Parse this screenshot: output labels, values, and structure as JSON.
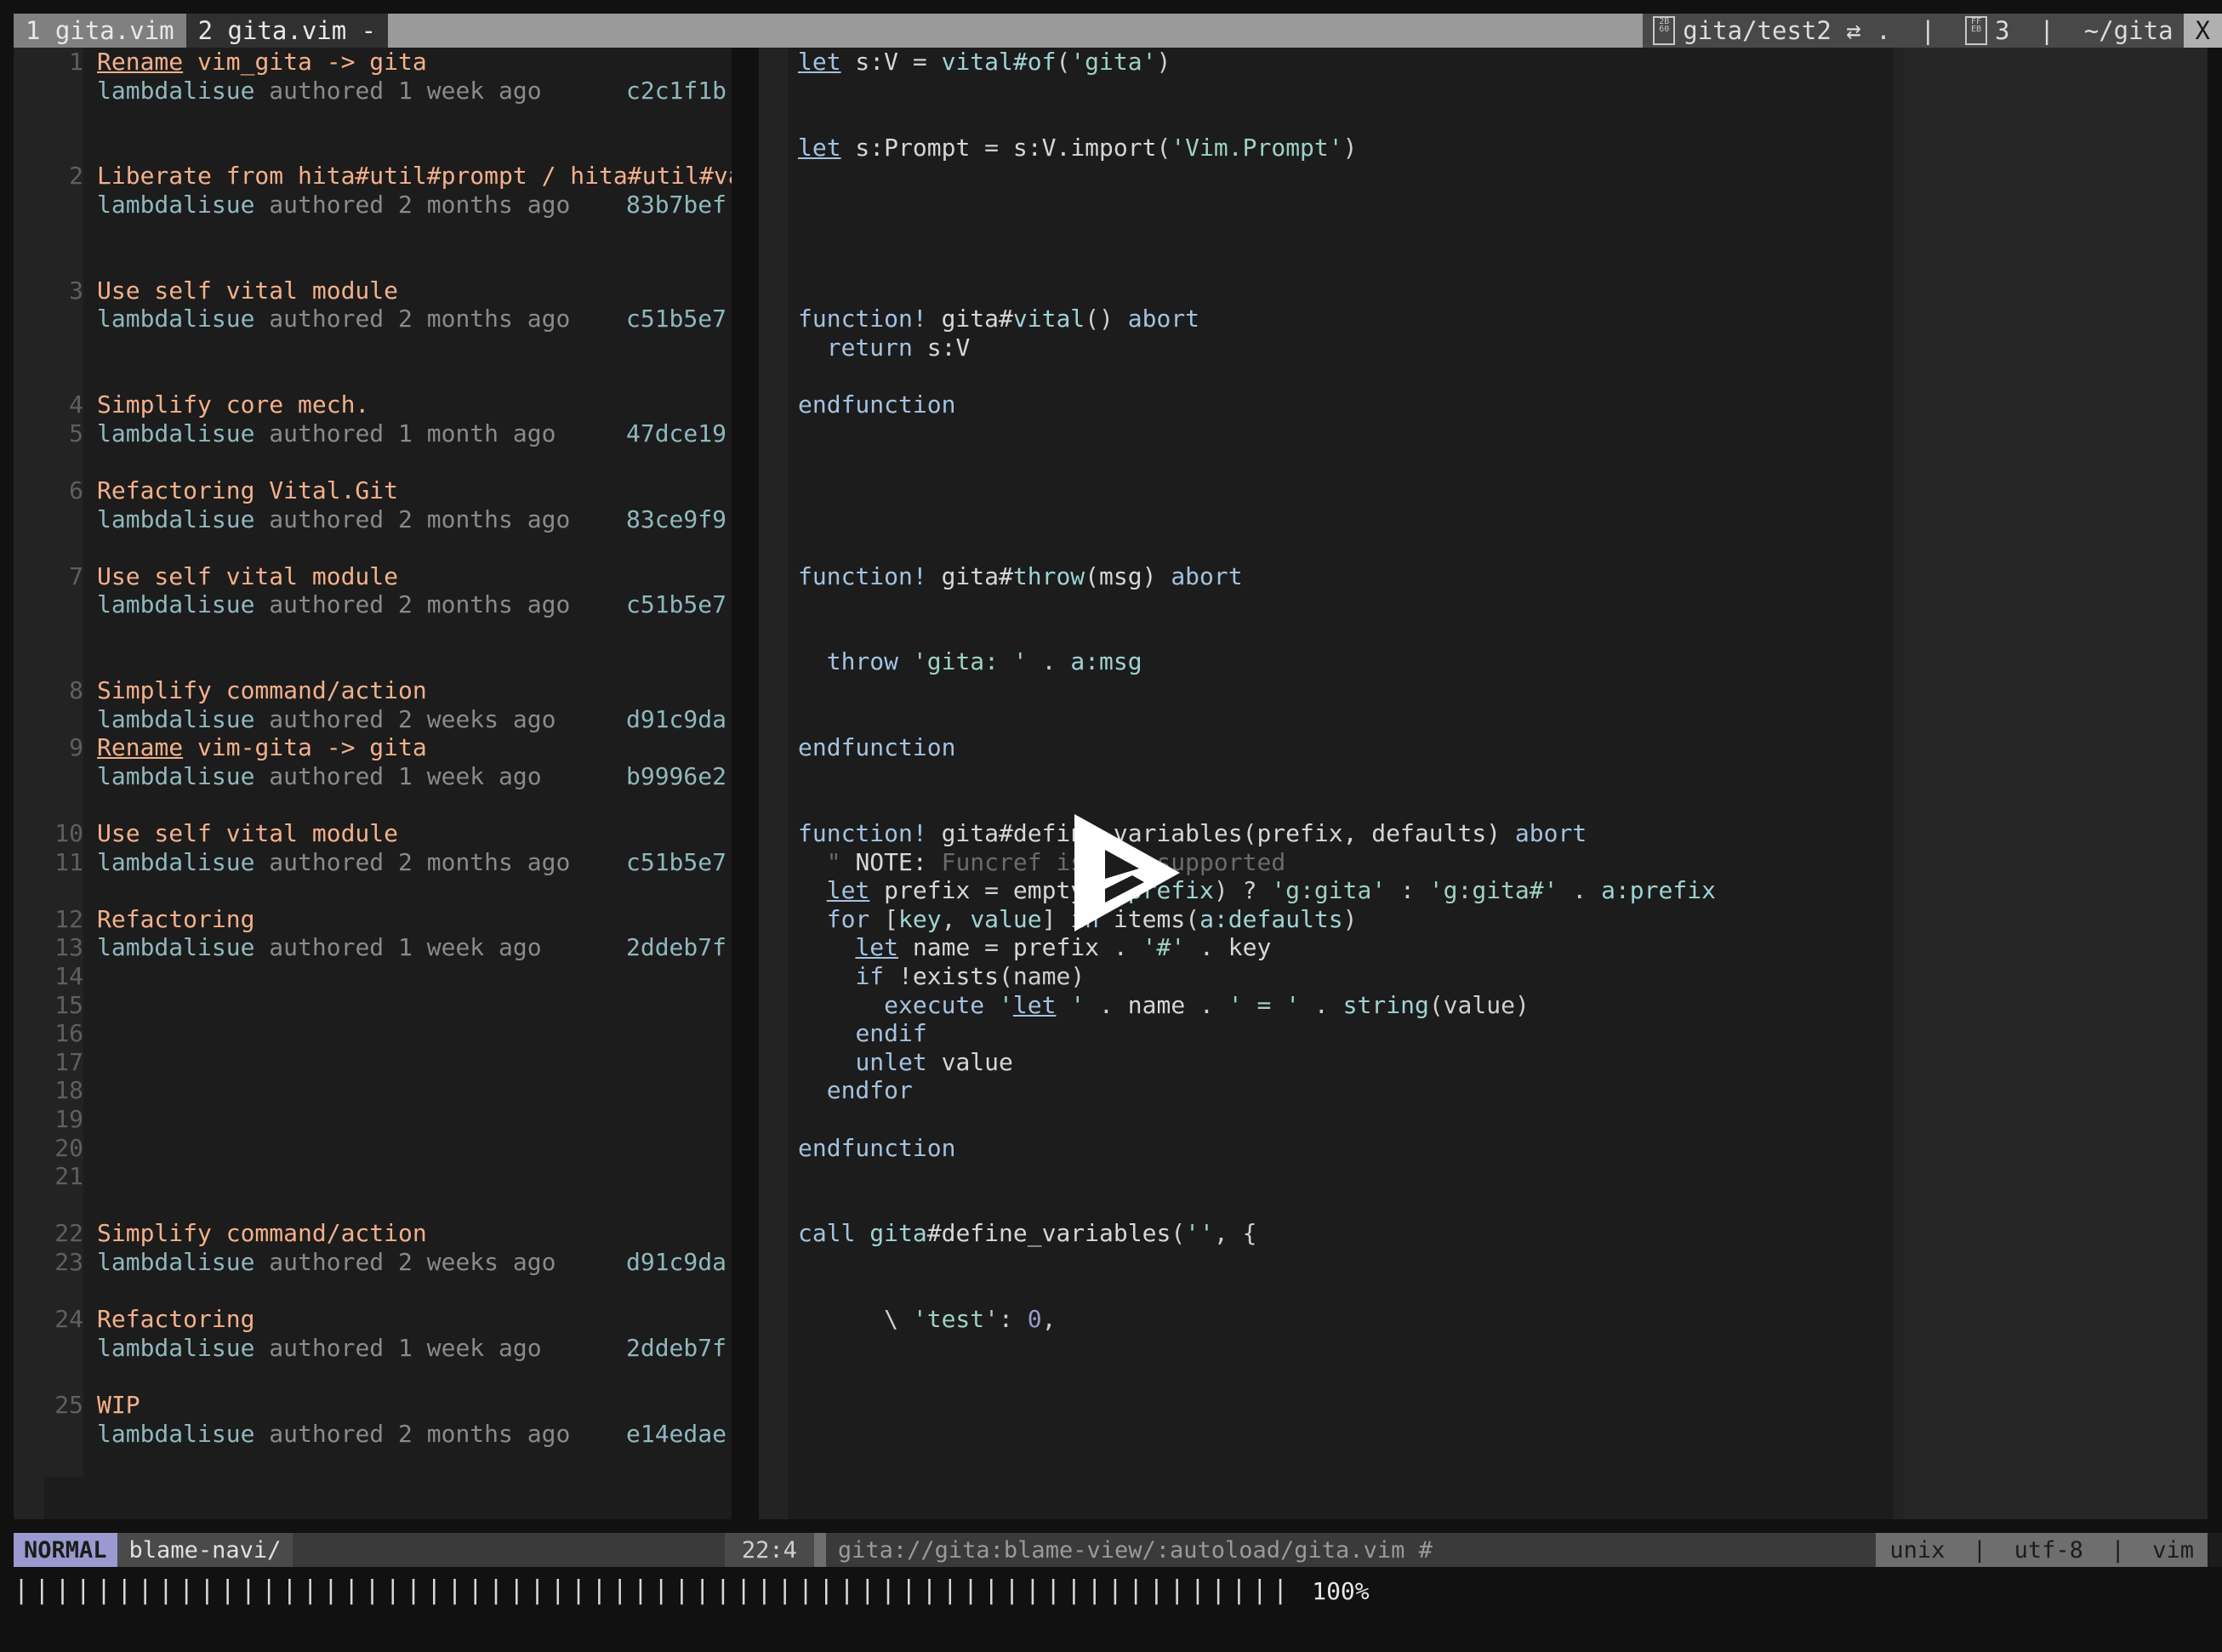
{
  "window": {
    "background": "#111111",
    "accent": "#9a9ad0"
  },
  "tabline": {
    "tabs": [
      {
        "label": "1 gita.vim",
        "active": false
      },
      {
        "label": "2 gita.vim -",
        "active": true
      }
    ],
    "info": {
      "branch_icon": "branch-box-glyph",
      "branch_glyph_top": "2B",
      "branch_glyph_bottom": "60",
      "branch": "gita/test2 ⇄ .",
      "divider1": "|",
      "count_glyph_top": "FF",
      "count_glyph_bottom": "EB",
      "count": "3",
      "divider2": "|",
      "cwd": "~/gita"
    },
    "close_label": "X"
  },
  "blame_pane": {
    "name": "blame-navi",
    "rows": [
      {
        "lnum": "1",
        "type": "title",
        "title_underline": "Rename",
        "title": " vim_gita -> gita"
      },
      {
        "lnum": "",
        "type": "author",
        "author": "lambdalisue",
        "meta": " authored 1 week ago",
        "hash": "c2c1f1b"
      },
      {
        "lnum": "",
        "type": "blank"
      },
      {
        "lnum": "",
        "type": "blank"
      },
      {
        "lnum": "2",
        "type": "title",
        "title": "Liberate from hita#util#prompt / hita#util#va"
      },
      {
        "lnum": "",
        "type": "author",
        "author": "lambdalisue",
        "meta": " authored 2 months ago",
        "hash": "83b7bef"
      },
      {
        "lnum": "",
        "type": "blank"
      },
      {
        "lnum": "",
        "type": "blank"
      },
      {
        "lnum": "3",
        "type": "title",
        "title": "Use self vital module"
      },
      {
        "lnum": "",
        "type": "author",
        "author": "lambdalisue",
        "meta": " authored 2 months ago",
        "hash": "c51b5e7"
      },
      {
        "lnum": "",
        "type": "blank"
      },
      {
        "lnum": "",
        "type": "blank"
      },
      {
        "lnum": "4",
        "type": "title",
        "title": "Simplify core mech."
      },
      {
        "lnum": "5",
        "type": "author",
        "author": "lambdalisue",
        "meta": " authored 1 month ago",
        "hash": "47dce19"
      },
      {
        "lnum": "",
        "type": "blank"
      },
      {
        "lnum": "6",
        "type": "title",
        "title": "Refactoring Vital.Git"
      },
      {
        "lnum": "",
        "type": "author",
        "author": "lambdalisue",
        "meta": " authored 2 months ago",
        "hash": "83ce9f9"
      },
      {
        "lnum": "",
        "type": "blank"
      },
      {
        "lnum": "7",
        "type": "title",
        "title": "Use self vital module"
      },
      {
        "lnum": "",
        "type": "author",
        "author": "lambdalisue",
        "meta": " authored 2 months ago",
        "hash": "c51b5e7"
      },
      {
        "lnum": "",
        "type": "blank"
      },
      {
        "lnum": "",
        "type": "blank"
      },
      {
        "lnum": "8",
        "type": "title",
        "title": "Simplify command/action"
      },
      {
        "lnum": "",
        "type": "author",
        "author": "lambdalisue",
        "meta": " authored 2 weeks ago",
        "hash": "d91c9da"
      },
      {
        "lnum": "9",
        "type": "title",
        "title_underline": "Rename",
        "title": " vim-gita -> gita"
      },
      {
        "lnum": "",
        "type": "author",
        "author": "lambdalisue",
        "meta": " authored 1 week ago",
        "hash": "b9996e2"
      },
      {
        "lnum": "",
        "type": "blank"
      },
      {
        "lnum": "10",
        "type": "title",
        "title": "Use self vital module"
      },
      {
        "lnum": "11",
        "type": "author",
        "author": "lambdalisue",
        "meta": " authored 2 months ago",
        "hash": "c51b5e7"
      },
      {
        "lnum": "",
        "type": "blank"
      },
      {
        "lnum": "12",
        "type": "title",
        "title": "Refactoring"
      },
      {
        "lnum": "13",
        "type": "author",
        "author": "lambdalisue",
        "meta": " authored 1 week ago",
        "hash": "2ddeb7f"
      },
      {
        "lnum": "14",
        "type": "blank"
      },
      {
        "lnum": "15",
        "type": "blank"
      },
      {
        "lnum": "16",
        "type": "blank"
      },
      {
        "lnum": "17",
        "type": "blank"
      },
      {
        "lnum": "18",
        "type": "blank"
      },
      {
        "lnum": "19",
        "type": "blank"
      },
      {
        "lnum": "20",
        "type": "blank"
      },
      {
        "lnum": "21",
        "type": "blank"
      },
      {
        "lnum": "",
        "type": "blank"
      },
      {
        "lnum": "22",
        "type": "title",
        "title": "Simplify command/action"
      },
      {
        "lnum": "23",
        "type": "author",
        "author": "lambdalisue",
        "meta": " authored 2 weeks ago",
        "hash": "d91c9da"
      },
      {
        "lnum": "",
        "type": "blank"
      },
      {
        "lnum": "24",
        "type": "title",
        "title": "Refactoring"
      },
      {
        "lnum": "",
        "type": "author",
        "author": "lambdalisue",
        "meta": " authored 1 week ago",
        "hash": "2ddeb7f"
      },
      {
        "lnum": "",
        "type": "blank"
      },
      {
        "lnum": "25",
        "type": "title",
        "title": "WIP"
      },
      {
        "lnum": "",
        "type": "author",
        "author": "lambdalisue",
        "meta": " authored 2 months ago",
        "hash": "e14edae"
      },
      {
        "lnum": "",
        "type": "blank"
      }
    ]
  },
  "code_pane": {
    "language": "vim",
    "lines": [
      [
        {
          "t": "let",
          "c": "ku"
        },
        {
          "t": " s:V ",
          "c": "id"
        },
        {
          "t": "=",
          "c": "op"
        },
        {
          "t": " ",
          "c": "id"
        },
        {
          "t": "vital#of",
          "c": "fn"
        },
        {
          "t": "(",
          "c": "op"
        },
        {
          "t": "'gita'",
          "c": "st"
        },
        {
          "t": ")",
          "c": "op"
        }
      ],
      [],
      [],
      [
        {
          "t": "let",
          "c": "ku"
        },
        {
          "t": " s:Prompt ",
          "c": "id"
        },
        {
          "t": "=",
          "c": "op"
        },
        {
          "t": " s:V.",
          "c": "id"
        },
        {
          "t": "import",
          "c": "id"
        },
        {
          "t": "(",
          "c": "op"
        },
        {
          "t": "'Vim.Prompt'",
          "c": "st"
        },
        {
          "t": ")",
          "c": "op"
        }
      ],
      [],
      [],
      [],
      [],
      [],
      [
        {
          "t": "function!",
          "c": "k"
        },
        {
          "t": " gita#",
          "c": "id"
        },
        {
          "t": "vital",
          "c": "fn"
        },
        {
          "t": "()",
          "c": "op"
        },
        {
          "t": " ",
          "c": "id"
        },
        {
          "t": "abort",
          "c": "k"
        }
      ],
      [
        {
          "t": "  ",
          "c": "id"
        },
        {
          "t": "return",
          "c": "k"
        },
        {
          "t": " s:V",
          "c": "id"
        }
      ],
      [],
      [
        {
          "t": "endfunction",
          "c": "k"
        }
      ],
      [],
      [],
      [],
      [],
      [],
      [
        {
          "t": "function!",
          "c": "k"
        },
        {
          "t": " gita#",
          "c": "id"
        },
        {
          "t": "throw",
          "c": "fn"
        },
        {
          "t": "(msg) ",
          "c": "id"
        },
        {
          "t": "abort",
          "c": "k"
        }
      ],
      [],
      [],
      [
        {
          "t": "  ",
          "c": "id"
        },
        {
          "t": "throw",
          "c": "k"
        },
        {
          "t": " ",
          "c": "id"
        },
        {
          "t": "'gita: '",
          "c": "st"
        },
        {
          "t": " . ",
          "c": "op"
        },
        {
          "t": "a:msg",
          "c": "fn"
        }
      ],
      [],
      [],
      [
        {
          "t": "endfunction",
          "c": "k"
        }
      ],
      [],
      [],
      [
        {
          "t": "function!",
          "c": "k"
        },
        {
          "t": " gita#define_variables",
          "c": "id"
        },
        {
          "t": "(prefix, defaults) ",
          "c": "id"
        },
        {
          "t": "abort",
          "c": "k"
        }
      ],
      [
        {
          "t": "  \" ",
          "c": "cm"
        },
        {
          "t": "NOTE:",
          "c": "cmk"
        },
        {
          "t": " Funcref is not supported",
          "c": "cm"
        }
      ],
      [
        {
          "t": "  ",
          "c": "id"
        },
        {
          "t": "let",
          "c": "ku"
        },
        {
          "t": " prefix ",
          "c": "id"
        },
        {
          "t": "=",
          "c": "op"
        },
        {
          "t": " ",
          "c": "id"
        },
        {
          "t": "empty",
          "c": "id"
        },
        {
          "t": "(",
          "c": "op"
        },
        {
          "t": "a:prefix",
          "c": "fn"
        },
        {
          "t": ") ? ",
          "c": "op"
        },
        {
          "t": "'g:gita'",
          "c": "st"
        },
        {
          "t": " : ",
          "c": "op"
        },
        {
          "t": "'g:gita#'",
          "c": "st"
        },
        {
          "t": " . ",
          "c": "op"
        },
        {
          "t": "a:prefix",
          "c": "fn"
        }
      ],
      [
        {
          "t": "  ",
          "c": "id"
        },
        {
          "t": "for",
          "c": "k"
        },
        {
          "t": " [",
          "c": "op"
        },
        {
          "t": "key",
          "c": "fn"
        },
        {
          "t": ", ",
          "c": "op"
        },
        {
          "t": "value",
          "c": "fn"
        },
        {
          "t": "] ",
          "c": "op"
        },
        {
          "t": "in",
          "c": "k"
        },
        {
          "t": " ",
          "c": "id"
        },
        {
          "t": "items",
          "c": "id"
        },
        {
          "t": "(",
          "c": "op"
        },
        {
          "t": "a:defaults",
          "c": "fn"
        },
        {
          "t": ")",
          "c": "op"
        }
      ],
      [
        {
          "t": "    ",
          "c": "id"
        },
        {
          "t": "let",
          "c": "ku"
        },
        {
          "t": " name ",
          "c": "id"
        },
        {
          "t": "=",
          "c": "op"
        },
        {
          "t": " prefix ",
          "c": "id"
        },
        {
          "t": ". ",
          "c": "op"
        },
        {
          "t": "'#'",
          "c": "st"
        },
        {
          "t": " . ",
          "c": "op"
        },
        {
          "t": "key",
          "c": "id"
        }
      ],
      [
        {
          "t": "    ",
          "c": "id"
        },
        {
          "t": "if",
          "c": "k"
        },
        {
          "t": " !",
          "c": "op"
        },
        {
          "t": "exists",
          "c": "id"
        },
        {
          "t": "(name)",
          "c": "op"
        }
      ],
      [
        {
          "t": "      ",
          "c": "id"
        },
        {
          "t": "execute",
          "c": "k"
        },
        {
          "t": " ",
          "c": "id"
        },
        {
          "t": "'",
          "c": "st"
        },
        {
          "t": "let",
          "c": "ku"
        },
        {
          "t": " '",
          "c": "st"
        },
        {
          "t": " . ",
          "c": "op"
        },
        {
          "t": "name",
          "c": "id"
        },
        {
          "t": " . ",
          "c": "op"
        },
        {
          "t": "' = '",
          "c": "st"
        },
        {
          "t": " . ",
          "c": "op"
        },
        {
          "t": "string",
          "c": "fn"
        },
        {
          "t": "(value)",
          "c": "op"
        }
      ],
      [
        {
          "t": "    ",
          "c": "id"
        },
        {
          "t": "endif",
          "c": "k"
        }
      ],
      [
        {
          "t": "    ",
          "c": "id"
        },
        {
          "t": "unlet",
          "c": "k"
        },
        {
          "t": " value",
          "c": "id"
        }
      ],
      [
        {
          "t": "  ",
          "c": "id"
        },
        {
          "t": "endfor",
          "c": "k"
        }
      ],
      [],
      [
        {
          "t": "endfunction",
          "c": "k"
        }
      ],
      [],
      [],
      [
        {
          "t": "call",
          "c": "k"
        },
        {
          "t": " ",
          "c": "id"
        },
        {
          "t": "gita",
          "c": "fn"
        },
        {
          "t": "#define_variables",
          "c": "id"
        },
        {
          "t": "(",
          "c": "op"
        },
        {
          "t": "''",
          "c": "st"
        },
        {
          "t": ", {",
          "c": "op"
        }
      ],
      [],
      [],
      [
        {
          "t": "      \\ ",
          "c": "op"
        },
        {
          "t": "'test'",
          "c": "st"
        },
        {
          "t": ": ",
          "c": "op"
        },
        {
          "t": "0",
          "c": "num"
        },
        {
          "t": ",",
          "c": "op"
        }
      ],
      []
    ]
  },
  "statusline": {
    "mode": "NORMAL",
    "filename": "blame-navi/",
    "position": "22:4",
    "path": "gita://gita:blame-view/:autoload/gita.vim #",
    "fileformat": "unix",
    "encoding": "utf-8",
    "filetype": "vim",
    "divider": "|"
  },
  "progress": {
    "percent": "100%",
    "tick_count": 62,
    "tick_char": "|"
  },
  "overlay": {
    "play_button": "play-icon"
  }
}
